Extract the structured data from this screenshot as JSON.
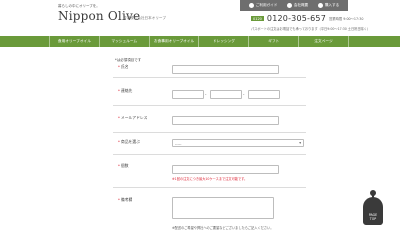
{
  "header": {
    "tagline": "暮らしの中にオリーブを。",
    "logo": "Nippon Olive",
    "subtitle": "香港株式会社日本オリーブ",
    "top_links": [
      {
        "label": "ご利用ガイド",
        "icon": "guide-icon"
      },
      {
        "label": "会社概要",
        "icon": "company-icon"
      },
      {
        "label": "購入する",
        "icon": "cart-icon"
      }
    ],
    "contact": {
      "badge": "0120",
      "phone": "0120-305-657",
      "hours": "営業時間 9:00〜17:30",
      "note": "パスポートの注文はお電話でも承っております（平日9:00〜17:30 土日祝日除く）"
    }
  },
  "nav": {
    "items": [
      "食用オリーブオイル",
      "マッシュルーム",
      "お食事用オリーブオイル",
      "ドレッシング",
      "ギフト",
      "注文ページ"
    ]
  },
  "form": {
    "required_note": "*は必須項目です",
    "required_mark": "*",
    "labels": {
      "name": "氏名",
      "phone": "連絡先",
      "email": "メールアドレス",
      "product": "商品を選ぶ",
      "quantity": "個数",
      "notes": "備考欄"
    },
    "phone_separator": "-",
    "product_select": {
      "value": "-----"
    },
    "quantity_hint": "※1回の注文につき最大10ケースまで注文可能です。",
    "notes_hint": "※配送のご希望や弊社へのご要望などございましたらご記入ください。"
  },
  "page_top": {
    "label_line1": "PAGE",
    "label_line2": "TOP"
  },
  "colors": {
    "accent_green": "#6a9a3a",
    "dark_gray": "#6e6e6e",
    "required_red": "#dd2233"
  }
}
